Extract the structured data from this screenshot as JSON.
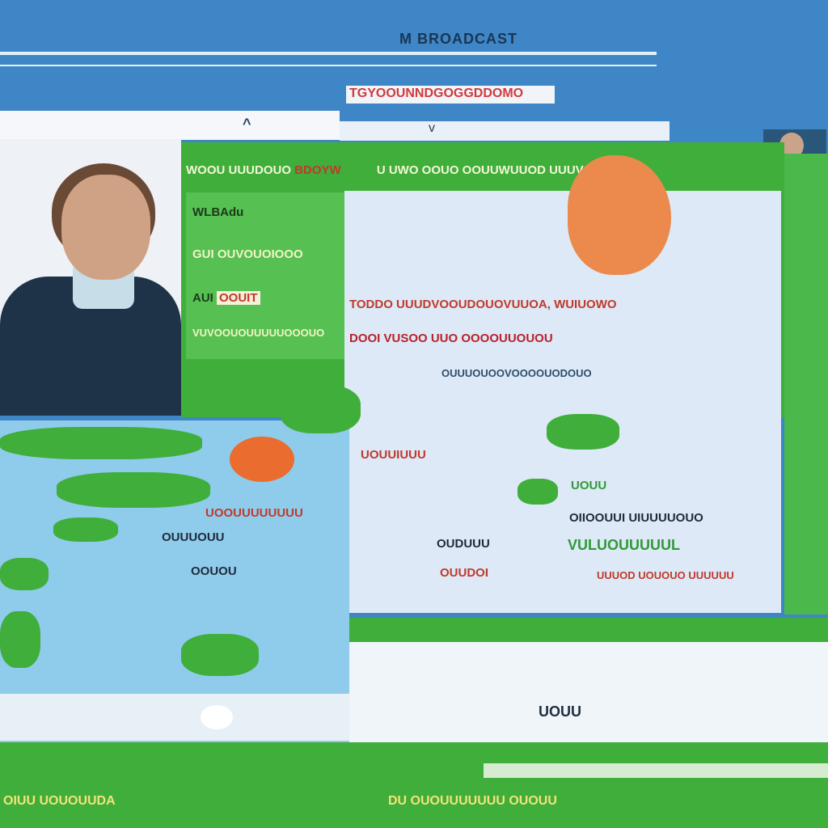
{
  "header": {
    "title": "M BROADCAST",
    "subtitle": "TGYOOUNNDGOGGDDOMO"
  },
  "tabs": {
    "left_label": "^",
    "right_chevron": "v"
  },
  "green_panel": {
    "header_text": "WOOU UUUDOUO",
    "header_highlight": "BDOYW",
    "header_right": "U UWO OOUO OOUUWUUOD UUUV OU",
    "card_line1": "WLBAdu",
    "card_line2": "GUI OUVOUOIOOO",
    "card_line3_prefix": "AUI",
    "card_line3_highlight": "OOUIT",
    "card_line4": "VUVOOUOUUUUUOOOUO"
  },
  "info_card": {
    "line1": "TODDO  UUUDVOOUDOUOVUUOA, WUIUOWO",
    "line2": "DOOI VUSOO  UUO OOOOUUOUOU",
    "line3": "OUUUOUOOVOOOOUODOUO"
  },
  "map": {
    "label1": "UOOUUUUUUUU",
    "label2": "OOUOU",
    "label3": "OUUUOUU",
    "label4": "UOUUIUUU"
  },
  "stats": {
    "s1": "UOUU",
    "s2": "OIIOOUUI UIUUUUOUO",
    "s3": "OUDUUU",
    "s4": "VULUOUUUUUL",
    "s5": "UUUOD UOUOUO UUUUUU",
    "s6": "OUUDOI"
  },
  "bottom_panel": {
    "label": "UOUU"
  },
  "footer": {
    "ticker_left": "OIUU UOUOUUDA",
    "ticker_right": "DU OUOUUUUUUU OUOUU"
  },
  "colors": {
    "background": "#3f86c6",
    "green": "#3fae3a",
    "red_text": "#c0392b",
    "orange_marker": "#eb8a4c"
  }
}
